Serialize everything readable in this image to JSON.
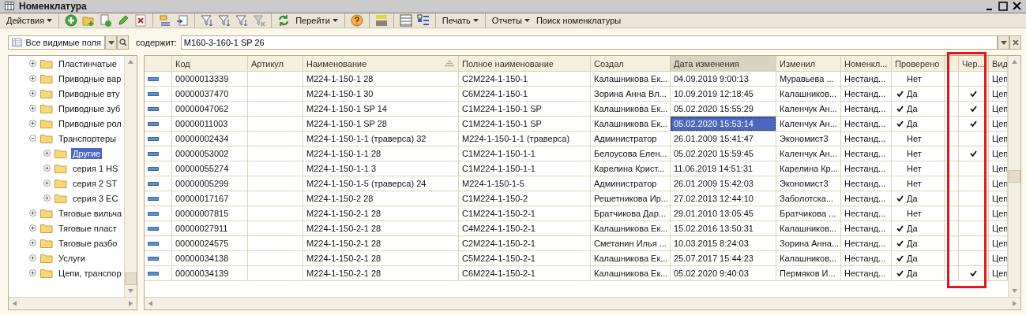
{
  "window": {
    "title": "Номенклатура"
  },
  "toolbar": {
    "actions": "Действия",
    "goto": "Перейти",
    "print": "Печать",
    "reports": "Отчеты",
    "search": "Поиск номенклатуры"
  },
  "filter": {
    "field": "Все видимые поля",
    "label": "содержит:",
    "value": "М160-3-160-1 SP 26"
  },
  "tree": [
    {
      "label": "Пластинчатые",
      "expanded": false,
      "selected": false
    },
    {
      "label": "Приводные вар",
      "expanded": false,
      "selected": false
    },
    {
      "label": "Приводные вту",
      "expanded": false,
      "selected": false
    },
    {
      "label": "Приводные зуб",
      "expanded": false,
      "selected": false
    },
    {
      "label": "Приводные рол",
      "expanded": false,
      "selected": false
    },
    {
      "label": "Транспортеры",
      "expanded": true,
      "selected": false,
      "children": [
        {
          "label": "Другие",
          "expanded": false,
          "selected": true
        },
        {
          "label": "серия 1 HS",
          "expanded": false,
          "selected": false
        },
        {
          "label": "серия 2 ST",
          "expanded": false,
          "selected": false
        },
        {
          "label": "серия 3 EC",
          "expanded": false,
          "selected": false
        }
      ]
    },
    {
      "label": "Тяговые вильча",
      "expanded": false,
      "selected": false
    },
    {
      "label": "Тяговые пласт",
      "expanded": false,
      "selected": false
    },
    {
      "label": "Тяговые разбо",
      "expanded": false,
      "selected": false
    },
    {
      "label": "Услуги",
      "expanded": false,
      "selected": false
    },
    {
      "label": "Цепи, транспор",
      "expanded": false,
      "selected": false
    }
  ],
  "table": {
    "columns": [
      {
        "label": "Код",
        "sorted": false
      },
      {
        "label": "Артикул",
        "sorted": false
      },
      {
        "label": "Наименование",
        "sorted": true
      },
      {
        "label": "Полное наименование",
        "sorted": false
      },
      {
        "label": "Создал",
        "sorted": false
      },
      {
        "label": "Дата изменения",
        "sorted": false,
        "current": true
      },
      {
        "label": "Изменил",
        "sorted": false
      },
      {
        "label": "Номенкл...",
        "sorted": false
      },
      {
        "label": "Проверено",
        "sorted": false
      },
      {
        "label": "Чер...",
        "sorted": false
      },
      {
        "label": "Вид",
        "sorted": false
      }
    ],
    "rows": [
      {
        "code": "00000013339",
        "name": "М224-1-150-1 28",
        "full_name": "С2М224-1-150-1",
        "created_by": "Калашникова Ек...",
        "modified": "04.09.2019 9:00:13",
        "modified_by": "Муравьева ...",
        "nomencl": "Нестанд...",
        "verified": false,
        "verified_label": "Нет",
        "cher": false,
        "kind_text": "Цеп",
        "selected": false
      },
      {
        "code": "00000037470",
        "name": "М224-1-150-1 30",
        "full_name": "С6М224-1-150-1",
        "created_by": "Зорина Анна Вл...",
        "modified": "10.09.2019 12:18:45",
        "modified_by": "Калашников...",
        "nomencl": "Нестанд...",
        "verified": true,
        "verified_label": "Да",
        "cher": true,
        "kind_text": "Цеп",
        "selected": false
      },
      {
        "code": "00000047062",
        "name": "М224-1-150-1 SP 14",
        "full_name": "С1М224-1-150-1 SP",
        "created_by": "Калашникова Ек...",
        "modified": "05.02.2020 15:55:29",
        "modified_by": "Каленчук Ан...",
        "nomencl": "Нестанд...",
        "verified": true,
        "verified_label": "Да",
        "cher": true,
        "kind_text": "Цеп",
        "selected": false
      },
      {
        "code": "00000011003",
        "name": "М224-1-150-1 SP 28",
        "full_name": "С1М224-1-150-1 SP",
        "created_by": "Калашникова Ек...",
        "modified": "05.02.2020 15:53:14",
        "modified_by": "Каленчук Ан...",
        "nomencl": "Нестанд...",
        "verified": true,
        "verified_label": "Да",
        "cher": true,
        "kind_text": "Цеп",
        "selected": true
      },
      {
        "code": "00000002434",
        "name": "М224-1-150-1-1 (траверса) 32",
        "full_name": "М224-1-150-1-1 (траверса)",
        "created_by": "Администратор",
        "modified": "26.01.2009 15:41:47",
        "modified_by": "Экономист3",
        "nomencl": "Нестанд...",
        "verified": false,
        "verified_label": "Нет",
        "cher": false,
        "kind_text": "Цеп",
        "selected": false
      },
      {
        "code": "00000053002",
        "name": "М224-1-150-1-1 28",
        "full_name": "С1М224-1-150-1-1",
        "created_by": "Белоусова Елен...",
        "modified": "05.02.2020 15:59:45",
        "modified_by": "Каленчук Ан...",
        "nomencl": "Нестанд...",
        "verified": false,
        "verified_label": "Нет",
        "cher": true,
        "kind_text": "Цеп",
        "selected": false
      },
      {
        "code": "00000055274",
        "name": "М224-1-150-1-1 3",
        "full_name": "С1М224-1-150-1-1",
        "created_by": "Карелина Крист...",
        "modified": "11.06.2019 14:51:31",
        "modified_by": "Карелина Кр...",
        "nomencl": "Нестанд...",
        "verified": false,
        "verified_label": "Нет",
        "cher": false,
        "kind_text": "Цеп",
        "selected": false
      },
      {
        "code": "00000005299",
        "name": "М224-1-150-1-5 (траверса) 24",
        "full_name": "М224-1-150-1-5",
        "created_by": "Администратор",
        "modified": "26.01.2009 15:42:03",
        "modified_by": "Экономист3",
        "nomencl": "Нестанд...",
        "verified": false,
        "verified_label": "Нет",
        "cher": false,
        "kind_text": "Цеп",
        "selected": false
      },
      {
        "code": "00000017167",
        "name": "М224-1-150-2 28",
        "full_name": "С1М224-1-150-2",
        "created_by": "Решетникова Ир...",
        "modified": "27.02.2013 12:44:10",
        "modified_by": "Заболотска...",
        "nomencl": "Нестанд...",
        "verified": true,
        "verified_label": "Да",
        "cher": false,
        "kind_text": "Цеп",
        "selected": false
      },
      {
        "code": "00000007815",
        "name": "М224-1-150-2-1 28",
        "full_name": "С1М224-1-150-2-1",
        "created_by": "Братчикова Дар...",
        "modified": "29.01.2010 13:05:45",
        "modified_by": "Братчикова ...",
        "nomencl": "Нестанд...",
        "verified": false,
        "verified_label": "Нет",
        "cher": false,
        "kind_text": "Цеп",
        "selected": false
      },
      {
        "code": "00000027911",
        "name": "М224-1-150-2-1 28",
        "full_name": "С4М224-1-150-2-1",
        "created_by": "Калашникова Ек...",
        "modified": "15.02.2016 13:50:31",
        "modified_by": "Калашников...",
        "nomencl": "Нестанд...",
        "verified": true,
        "verified_label": "Да",
        "cher": false,
        "kind_text": "Цеп",
        "selected": false
      },
      {
        "code": "00000024575",
        "name": "М224-1-150-2-1 28",
        "full_name": "С2М224-1-150-2-1",
        "created_by": "Сметанин Илья ...",
        "modified": "10.03.2015 8:24:03",
        "modified_by": "Зорина Анна...",
        "nomencl": "Нестанд...",
        "verified": true,
        "verified_label": "Да",
        "cher": false,
        "kind_text": "Цеп",
        "selected": false
      },
      {
        "code": "00000034138",
        "name": "М224-1-150-2-1 28",
        "full_name": "С5М224-1-150-2-1",
        "created_by": "Калашникова Ек...",
        "modified": "25.07.2017 15:44:23",
        "modified_by": "Калашников...",
        "nomencl": "Нестанд...",
        "verified": true,
        "verified_label": "Да",
        "cher": false,
        "kind_text": "Цеп",
        "selected": false
      },
      {
        "code": "00000034139",
        "name": "М224-1-150-2-1 28",
        "full_name": "С6М224-1-150-2-1",
        "created_by": "Калашникова Ек...",
        "modified": "05.02.2020 9:40:03",
        "modified_by": "Пермяков И...",
        "nomencl": "Нестанд...",
        "verified": true,
        "verified_label": "Да",
        "cher": true,
        "kind_text": "Цеп",
        "selected": false
      }
    ]
  }
}
